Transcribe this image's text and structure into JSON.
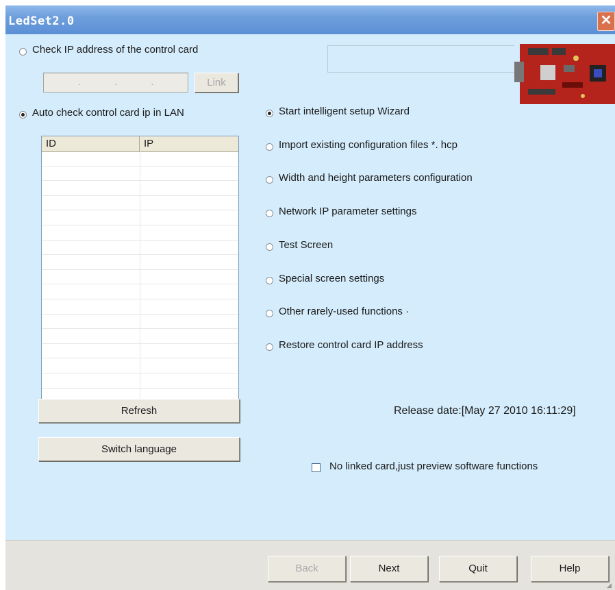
{
  "window": {
    "title": "LedSet2.0",
    "close_icon": "close-icon"
  },
  "check_ip": {
    "label": "Check IP address of the control card",
    "ip_dots": [
      ".",
      ".",
      "."
    ],
    "link_label": "Link"
  },
  "auto_check": {
    "label": "Auto check control card ip in LAN",
    "columns": [
      "ID",
      "IP"
    ],
    "refresh_label": "Refresh",
    "switch_language_label": "Switch language"
  },
  "options": [
    {
      "label": "Start intelligent setup Wizard",
      "selected": true
    },
    {
      "label": "Import existing configuration files *. hcp",
      "selected": false
    },
    {
      "label": "Width and height parameters configuration",
      "selected": false
    },
    {
      "label": "Network IP parameter settings",
      "selected": false
    },
    {
      "label": "Test Screen",
      "selected": false
    },
    {
      "label": "Special screen settings",
      "selected": false
    },
    {
      "label": "Other rarely-used functions ·",
      "selected": false
    },
    {
      "label": "Restore control card IP address",
      "selected": false
    }
  ],
  "release_date": "Release date:[May 27 2010 16:11:29]",
  "preview_checkbox": {
    "label": "No linked card,just preview software functions",
    "checked": false
  },
  "footer": {
    "back_label": "Back",
    "next_label": "Next",
    "quit_label": "Quit",
    "help_label": "Help"
  },
  "colors": {
    "title_bar": "#6e9fdc",
    "client_bg": "#d4ecfb",
    "close_button": "#d9714e",
    "board_red": "#b4241c"
  }
}
